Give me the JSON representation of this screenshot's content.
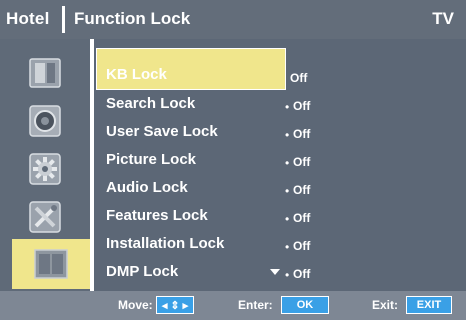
{
  "header": {
    "title": "Hotel",
    "subtitle": "Function Lock",
    "source": "TV"
  },
  "sidebar": {
    "items": [
      {
        "icon": "picture-icon"
      },
      {
        "icon": "audio-icon"
      },
      {
        "icon": "gear-icon"
      },
      {
        "icon": "tools-icon"
      },
      {
        "icon": "lock-panel-icon",
        "active": true
      }
    ]
  },
  "menu": {
    "items": [
      {
        "label": "KB Lock",
        "value": "Off",
        "selected": true
      },
      {
        "label": "Search Lock",
        "value": "Off"
      },
      {
        "label": "User Save Lock",
        "value": "Off"
      },
      {
        "label": "Picture Lock",
        "value": "Off"
      },
      {
        "label": "Audio Lock",
        "value": "Off"
      },
      {
        "label": "Features Lock",
        "value": "Off"
      },
      {
        "label": "Installation Lock",
        "value": "Off"
      },
      {
        "label": "DMP Lock",
        "value": "Off"
      }
    ],
    "bullet": "•"
  },
  "footer": {
    "move_label": "Move:",
    "move_button": "◂ ⇕ ▸",
    "enter_label": "Enter:",
    "enter_button": "OK",
    "exit_label": "Exit:",
    "exit_button": "EXIT"
  },
  "colors": {
    "header_bg": "#636d7a",
    "panel_bg": "#5c6776",
    "highlight": "#f0e68c",
    "footer_bg": "#7e8794",
    "button_blue": "#3aa0e6"
  }
}
